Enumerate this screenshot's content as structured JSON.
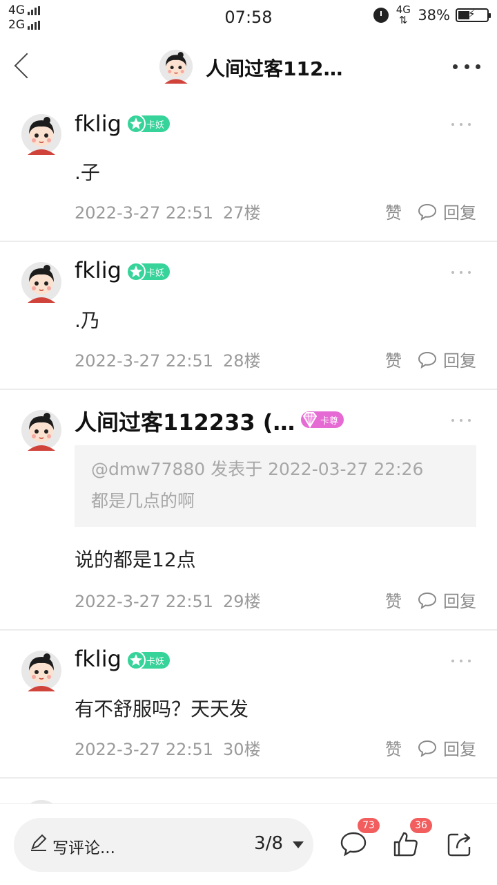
{
  "status_bar": {
    "sim1": "4G",
    "sim2": "2G",
    "time": "07:58",
    "network": "4G",
    "battery": "38%",
    "battery_level": 0.38
  },
  "header": {
    "title": "人间过客112…",
    "avatar_icon": "avatar-girl-icon",
    "back_icon": "back-arrow-icon",
    "more_icon": "more-dots-icon"
  },
  "posts": [
    {
      "username": "fklig",
      "badge": "卡妖",
      "badge_color": "#36d39a",
      "content": ".子",
      "date": "2022-3-27 22:51",
      "floor": "27楼",
      "like": "赞",
      "reply": "回复"
    },
    {
      "username": "fklig",
      "badge": "卡妖",
      "badge_color": "#36d39a",
      "content": ".乃",
      "date": "2022-3-27 22:51",
      "floor": "28楼",
      "like": "赞",
      "reply": "回复"
    },
    {
      "username": "人间过客112233 (…",
      "badge": "卡尊",
      "badge_color": "#e66ad3",
      "quote_header": "@dmw77880 发表于 2022-03-27 22:26",
      "quote_text": "都是几点的啊",
      "content": "说的都是12点",
      "date": "2022-3-27 22:51",
      "floor": "29楼",
      "like": "赞",
      "reply": "回复"
    },
    {
      "username": "fklig",
      "badge": "卡妖",
      "badge_color": "#36d39a",
      "content": "有不舒服吗？天天发",
      "date": "2022-3-27 22:51",
      "floor": "30楼",
      "like": "赞",
      "reply": "回复"
    }
  ],
  "bottom_bar": {
    "comment_placeholder": "写评论...",
    "page_indicator": "3/8",
    "comments_count": "73",
    "likes_count": "36"
  }
}
